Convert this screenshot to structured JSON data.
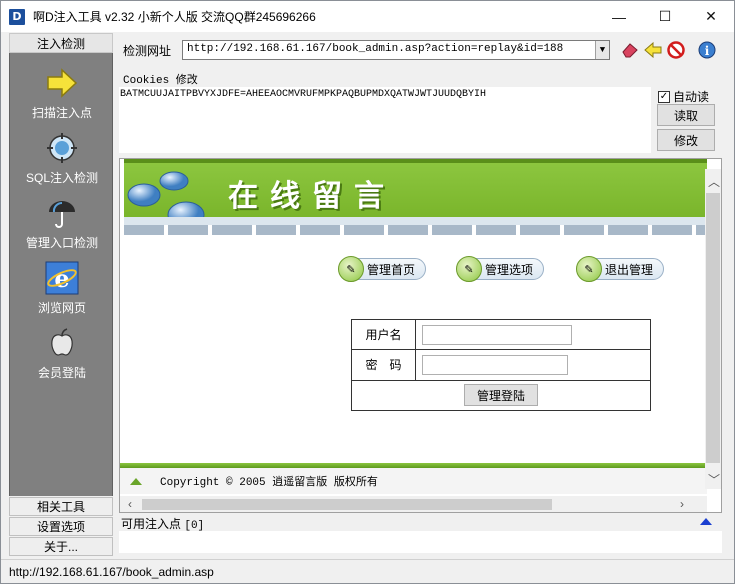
{
  "window": {
    "app_icon_letter": "D",
    "title": "啊D注入工具 v2.32 小新个人版 交流QQ群245696266",
    "minimize": "—",
    "maximize": "☐",
    "close": "✕"
  },
  "sidebar": {
    "header": "注入检测",
    "items": [
      {
        "label": "扫描注入点"
      },
      {
        "label": "SQL注入检测"
      },
      {
        "label": "管理入口检测"
      },
      {
        "label": "浏览网页"
      },
      {
        "label": "会员登陆"
      }
    ],
    "bottom_buttons": [
      {
        "label": "相关工具"
      },
      {
        "label": "设置选项"
      },
      {
        "label": "关于..."
      }
    ]
  },
  "toolbar": {
    "url_label": "检测网址",
    "url_value": "http://192.168.61.167/book_admin.asp?action=replay&id=188",
    "cookies_label": "Cookies 修改",
    "cookies_value": "BATMCUUJAITPBVYXJDFE=AHEEAOCMVRUFMPKPAQBUPMDXQATWJWTJUUDQBYIH",
    "auto_read_label": "自动读",
    "auto_read_checked": true,
    "read_button": "读取",
    "modify_button": "修改"
  },
  "webpage": {
    "banner_title": "在线留言",
    "nav": [
      {
        "label": "管理首页"
      },
      {
        "label": "管理选项"
      },
      {
        "label": "退出管理"
      }
    ],
    "login": {
      "username_label": "用户名",
      "password_label": "密　码",
      "submit": "管理登陆"
    },
    "footer": "Copyright © 2005 逍遥留言版 版权所有"
  },
  "injection": {
    "label": "可用注入点",
    "count": "[0]"
  },
  "statusbar": {
    "text": "http://192.168.61.167/book_admin.asp"
  }
}
